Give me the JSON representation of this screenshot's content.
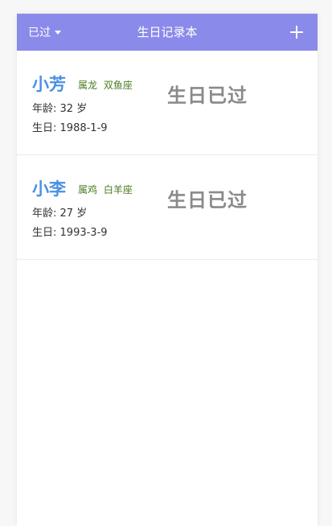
{
  "navbar": {
    "filter_label": "已过",
    "title": "生日记录本",
    "add_icon": "plus-icon"
  },
  "colors": {
    "navbar_bg": "#8a8aea",
    "name": "#4a90e2",
    "tags": "#4b7a1f",
    "status": "#8a8a8a"
  },
  "records": [
    {
      "name": "小芳",
      "zodiac": "属龙",
      "constellation": "双鱼座",
      "age_label": "年龄:",
      "age_value": "32",
      "age_unit": "岁",
      "birth_label": "生日:",
      "birth_value": "1988-1-9",
      "status": "生日已过"
    },
    {
      "name": "小李",
      "zodiac": "属鸡",
      "constellation": "白羊座",
      "age_label": "年龄:",
      "age_value": "27",
      "age_unit": "岁",
      "birth_label": "生日:",
      "birth_value": "1993-3-9",
      "status": "生日已过"
    }
  ]
}
